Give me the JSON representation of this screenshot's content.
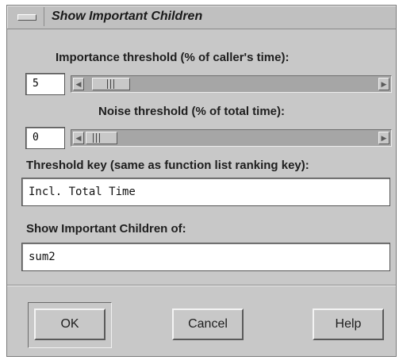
{
  "window": {
    "title": "Show Important Children"
  },
  "importance": {
    "label": "Importance threshold (% of caller's time):",
    "value": "5",
    "slider_fraction": 0.05
  },
  "noise": {
    "label": "Noise threshold (% of total time):",
    "value": "0",
    "slider_fraction": 0.0
  },
  "threshold_key": {
    "label": "Threshold key (same as function list ranking key):",
    "value": "Incl. Total Time"
  },
  "children_of": {
    "label": "Show Important Children of:",
    "value": "sum2"
  },
  "buttons": {
    "ok": "OK",
    "cancel": "Cancel",
    "help": "Help"
  },
  "icons": {
    "window_menu": "window-menu-icon",
    "arrow_left": "arrow-left-icon",
    "arrow_right": "arrow-right-icon"
  },
  "colors": {
    "window_bg": "#c8c8c8",
    "trough": "#a6a6a6",
    "field_bg": "#ffffff"
  }
}
